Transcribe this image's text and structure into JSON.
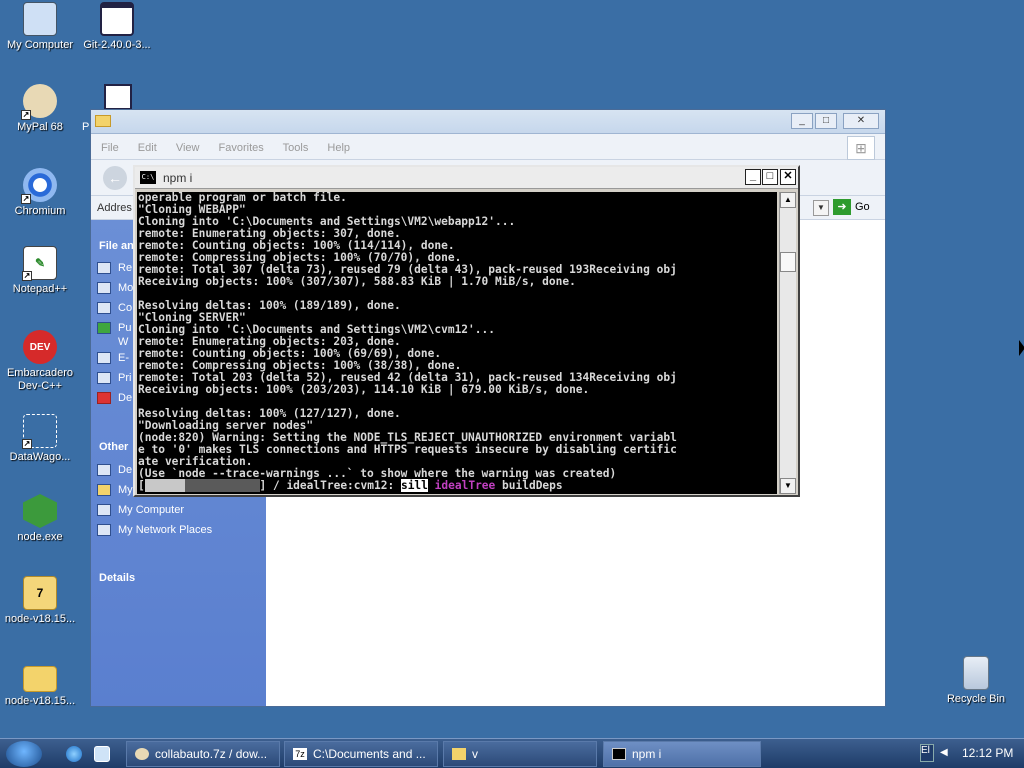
{
  "desktop": {
    "icons": [
      {
        "label": "My Computer",
        "icon": "computer-icon"
      },
      {
        "label": "Git-2.40.0-3...",
        "icon": "installer-icon"
      },
      {
        "label": "MyPal 68",
        "icon": "mypal-icon"
      },
      {
        "label": "Chromium",
        "icon": "chromium-icon"
      },
      {
        "label": "Notepad++",
        "icon": "notepadpp-icon"
      },
      {
        "label": "Embarcadero Dev-C++",
        "icon": "devcpp-icon"
      },
      {
        "label": "DataWago...",
        "icon": "datawagon-icon"
      },
      {
        "label": "node.exe",
        "icon": "nodejs-icon"
      },
      {
        "label": "node-v18.15...",
        "icon": "7zip-archive-icon"
      },
      {
        "label": "node-v18.15...",
        "icon": "folder-icon"
      },
      {
        "label": "Recycle Bin",
        "icon": "recycle-bin-icon"
      }
    ],
    "partial_label": "P"
  },
  "explorer": {
    "menu": [
      "File",
      "Edit",
      "View",
      "Favorites",
      "Tools",
      "Help"
    ],
    "address_label": "Addres",
    "go_label": "Go",
    "sidebar": {
      "file_tasks_head": "File an",
      "file_tasks": [
        "Re",
        "Mo",
        "Co",
        "Pu",
        "E-",
        "Pri",
        "De"
      ],
      "file_tasks_extra": "W",
      "other_places_head": "Other",
      "other_places": [
        "De",
        "My",
        "My Computer",
        "My Network Places"
      ],
      "details_head": "Details"
    },
    "caption_buttons": {
      "minimize": "_",
      "maximize": "□",
      "close": "✕"
    }
  },
  "cmd": {
    "title": "npm i",
    "icon_text": "C:\\",
    "caption_buttons": {
      "minimize": "_",
      "maximize": "□",
      "close": "✕"
    },
    "lines": [
      "operable program or batch file.",
      "\"Cloning WEBAPP\"",
      "Cloning into 'C:\\Documents and Settings\\VM2\\webapp12'...",
      "remote: Enumerating objects: 307, done.",
      "remote: Counting objects: 100% (114/114), done.",
      "remote: Compressing objects: 100% (70/70), done.",
      "remote: Total 307 (delta 73), reused 79 (delta 43), pack-reused 193Receiving obj",
      "Receiving objects: 100% (307/307), 588.83 KiB | 1.70 MiB/s, done.",
      "",
      "Resolving deltas: 100% (189/189), done.",
      "\"Cloning SERVER\"",
      "Cloning into 'C:\\Documents and Settings\\VM2\\cvm12'...",
      "remote: Enumerating objects: 203, done.",
      "remote: Counting objects: 100% (69/69), done.",
      "remote: Compressing objects: 100% (38/38), done.",
      "remote: Total 203 (delta 52), reused 42 (delta 31), pack-reused 134Receiving obj",
      "Receiving objects: 100% (203/203), 114.10 KiB | 679.00 KiB/s, done.",
      "",
      "Resolving deltas: 100% (127/127), done.",
      "\"Downloading server nodes\"",
      "(node:820) Warning: Setting the NODE_TLS_REJECT_UNAUTHORIZED environment variabl",
      "e to '0' makes TLS connections and HTTPS requests insecure by disabling certific",
      "ate verification.",
      "(Use `node --trace-warnings ...` to show where the warning was created)"
    ],
    "progress_line": {
      "open": "[",
      "close": "] / idealTree:cvm12: ",
      "level": "sill",
      "stage": "idealTree",
      "task": " buildDeps"
    },
    "progress_fraction": 0.35
  },
  "taskbar": {
    "buttons": [
      {
        "label": "collabauto.7z / dow...",
        "icon": "mypal-icon",
        "active": false
      },
      {
        "label": "C:\\Documents and ...",
        "icon": "7zip-icon",
        "active": false
      },
      {
        "label": "v",
        "icon": "folder-icon",
        "active": false
      },
      {
        "label": "npm i",
        "icon": "cmd-icon",
        "active": true
      }
    ],
    "language": "El",
    "time": "12:12 PM"
  },
  "colors": {
    "desktop": "#3a6ea5",
    "cmd_bg": "#000000",
    "cmd_text": "#d8d8d8",
    "npm_stage": "#c040c0"
  }
}
